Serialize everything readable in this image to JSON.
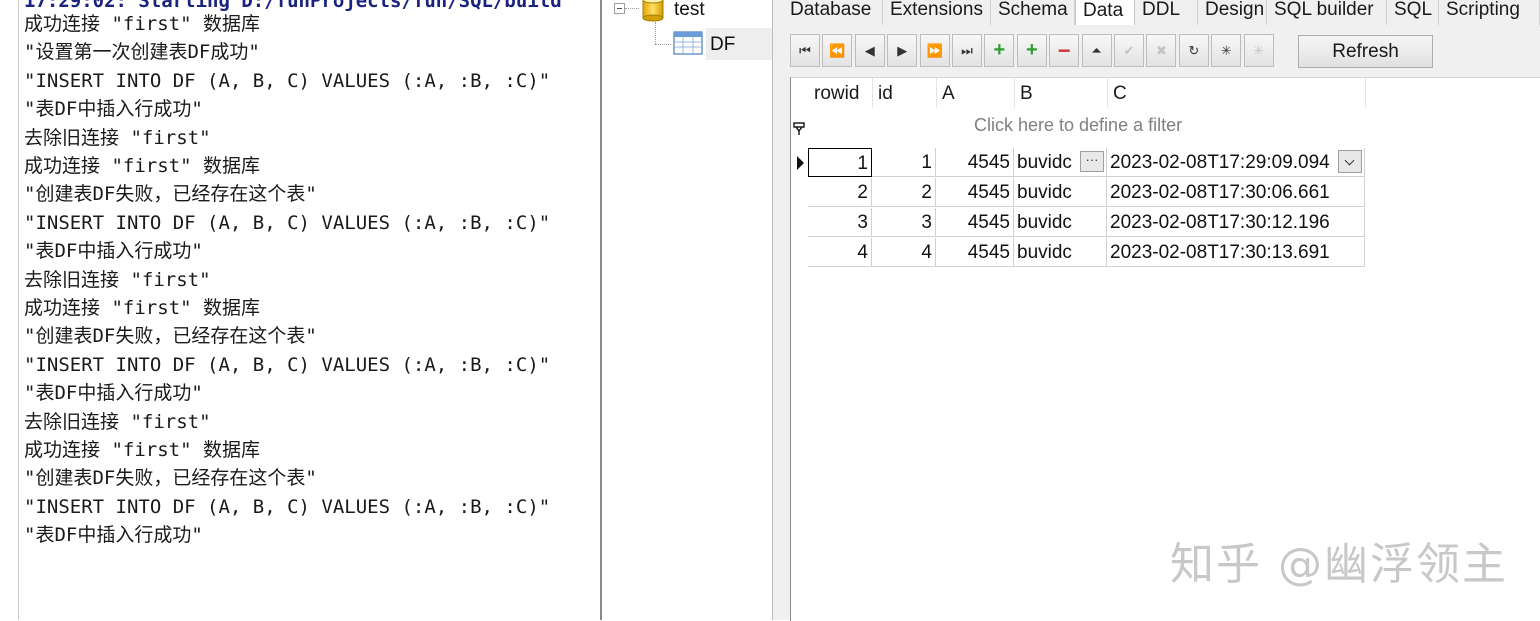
{
  "console": {
    "header": "17:29:02: Starting D:/funProjects/fun/SQL/build",
    "lines": [
      "成功连接 \"first\" 数据库",
      "\"设置第一次创建表DF成功\"",
      "\"INSERT INTO DF (A, B, C) VALUES (:A, :B, :C)\"",
      "\"表DF中插入行成功\"",
      "去除旧连接 \"first\"",
      "成功连接 \"first\" 数据库",
      "\"创建表DF失败，已经存在这个表\"",
      "\"INSERT INTO DF (A, B, C) VALUES (:A, :B, :C)\"",
      "\"表DF中插入行成功\"",
      "去除旧连接 \"first\"",
      "成功连接 \"first\" 数据库",
      "\"创建表DF失败，已经存在这个表\"",
      "\"INSERT INTO DF (A, B, C) VALUES (:A, :B, :C)\"",
      "\"表DF中插入行成功\"",
      "去除旧连接 \"first\"",
      "成功连接 \"first\" 数据库",
      "\"创建表DF失败，已经存在这个表\"",
      "\"INSERT INTO DF (A, B, C) VALUES (:A, :B, :C)\"",
      "\"表DF中插入行成功\""
    ]
  },
  "tree": {
    "database": "test",
    "table": "DF"
  },
  "tabs": [
    "Database",
    "Extensions",
    "Schema",
    "Data",
    "DDL",
    "Design",
    "SQL builder",
    "SQL",
    "Scripting"
  ],
  "active_tab": "Data",
  "toolbar": {
    "buttons": [
      {
        "name": "first-record-icon",
        "glyph": "⏮",
        "enabled": true
      },
      {
        "name": "prior-page-icon",
        "glyph": "⏪",
        "enabled": true
      },
      {
        "name": "prior-record-icon",
        "glyph": "◀",
        "enabled": true
      },
      {
        "name": "next-record-icon",
        "glyph": "▶",
        "enabled": true
      },
      {
        "name": "next-page-icon",
        "glyph": "⏩",
        "enabled": true
      },
      {
        "name": "last-record-icon",
        "glyph": "⏭",
        "enabled": true
      },
      {
        "name": "insert-record-icon",
        "glyph": "+",
        "enabled": true
      },
      {
        "name": "append-record-icon",
        "glyph": "+",
        "enabled": true
      },
      {
        "name": "delete-record-icon",
        "glyph": "−",
        "enabled": true
      },
      {
        "name": "edit-record-icon",
        "glyph": "⏶",
        "enabled": true
      },
      {
        "name": "post-edit-icon",
        "glyph": "✔",
        "enabled": false
      },
      {
        "name": "cancel-edit-icon",
        "glyph": "✖",
        "enabled": false
      },
      {
        "name": "refresh-data-icon",
        "glyph": "↻",
        "enabled": true
      },
      {
        "name": "set-null-icon",
        "glyph": "✳",
        "enabled": true
      },
      {
        "name": "clear-null-icon",
        "glyph": "✳",
        "enabled": false
      }
    ],
    "refresh_label": "Refresh"
  },
  "grid": {
    "columns": [
      "rowid",
      "id",
      "A",
      "B",
      "C"
    ],
    "filter_placeholder": "Click here to define a filter",
    "rows": [
      {
        "rowid": "1",
        "id": "1",
        "A": "4545",
        "B": "buvidc",
        "C": "2023-02-08T17:29:09.094"
      },
      {
        "rowid": "2",
        "id": "2",
        "A": "4545",
        "B": "buvidc",
        "C": "2023-02-08T17:30:06.661"
      },
      {
        "rowid": "3",
        "id": "3",
        "A": "4545",
        "B": "buvidc",
        "C": "2023-02-08T17:30:12.196"
      },
      {
        "rowid": "4",
        "id": "4",
        "A": "4545",
        "B": "buvidc",
        "C": "2023-02-08T17:30:13.691"
      }
    ],
    "ellipsis_glyph": "···"
  },
  "watermark": "知乎 @幽浮领主",
  "colors": {
    "console_header": "#1a237e",
    "accent_plus": "#2e9d2e",
    "accent_minus": "#d32f2f"
  }
}
